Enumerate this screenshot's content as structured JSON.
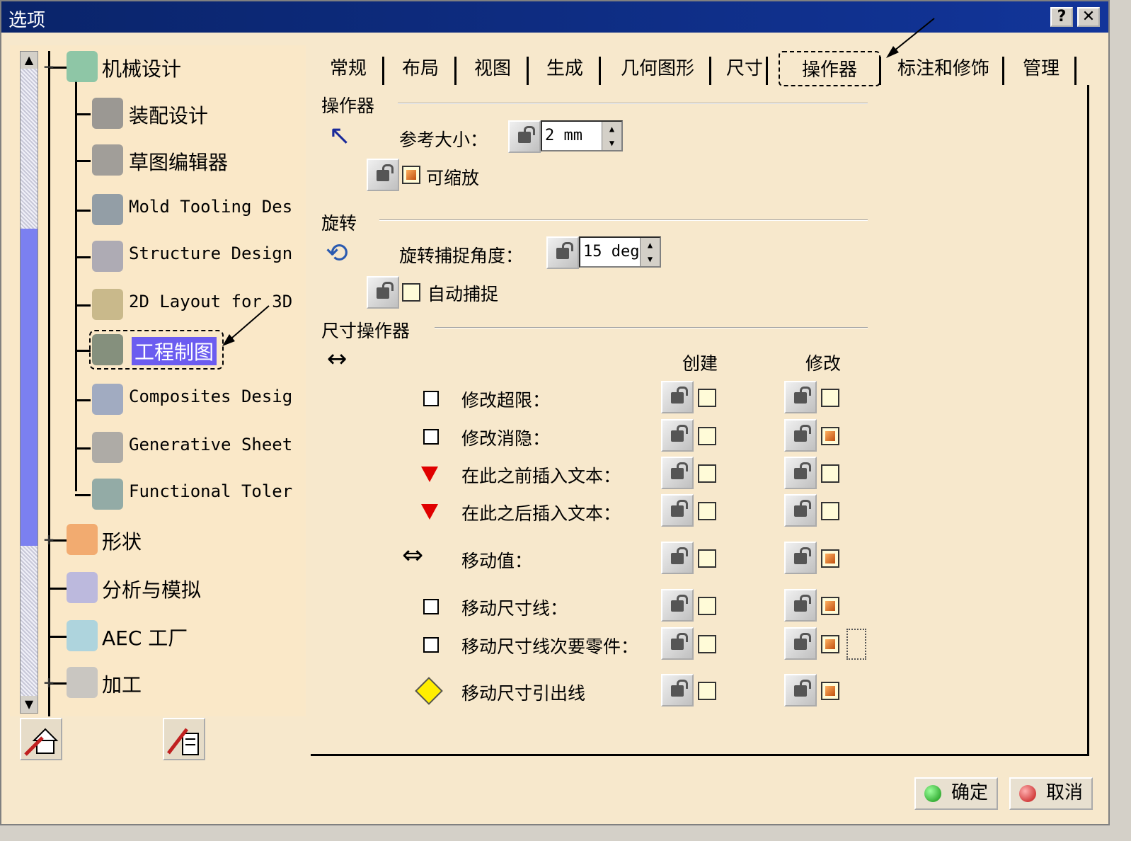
{
  "window": {
    "title": "选项",
    "help_label": "?",
    "close_label": "✕"
  },
  "tree": {
    "items": [
      {
        "label": "机械设计",
        "mono": false
      },
      {
        "label": "装配设计",
        "mono": false
      },
      {
        "label": "草图编辑器",
        "mono": false
      },
      {
        "label": "Mold Tooling Des",
        "mono": true
      },
      {
        "label": "Structure Design",
        "mono": true
      },
      {
        "label": "2D Layout for 3D",
        "mono": true
      },
      {
        "label": "工程制图",
        "mono": false,
        "selected": true
      },
      {
        "label": "Composites Desig",
        "mono": true
      },
      {
        "label": "Generative Sheet",
        "mono": true
      },
      {
        "label": "Functional Toler",
        "mono": true
      },
      {
        "label": "形状",
        "mono": false
      },
      {
        "label": "分析与模拟",
        "mono": false
      },
      {
        "label": "AEC 工厂",
        "mono": false
      },
      {
        "label": "加工",
        "mono": false
      }
    ],
    "expander_plus": "+",
    "expander_minus": "−",
    "scroll_up": "▲",
    "scroll_down": "▼"
  },
  "tabs": [
    "常规",
    "布局",
    "视图",
    "生成",
    "几何图形",
    "尺寸",
    "操作器",
    "标注和修饰",
    "管理"
  ],
  "active_tab": "操作器",
  "sections": {
    "manipulator": {
      "title": "操作器",
      "ref_size_label": "参考大小：",
      "ref_size_value": "2 mm",
      "scalable_label": "可缩放",
      "scalable_checked": true
    },
    "rotation": {
      "title": "旋转",
      "snap_angle_label": "旋转捕捉角度：",
      "snap_angle_value": "15 deg",
      "auto_snap_label": "自动捕捉",
      "auto_snap_checked": false
    },
    "dimension": {
      "title": "尺寸操作器",
      "col_create": "创建",
      "col_modify": "修改",
      "rows": [
        {
          "label": "修改超限：",
          "marker": "square",
          "create": false,
          "modify": false
        },
        {
          "label": "修改消隐：",
          "marker": "square",
          "create": false,
          "modify": true
        },
        {
          "label": "在此之前插入文本：",
          "marker": "red-triangle",
          "create": false,
          "modify": false
        },
        {
          "label": "在此之后插入文本：",
          "marker": "red-triangle",
          "create": false,
          "modify": false
        },
        {
          "label": "移动值：",
          "marker": "double-arrow",
          "create": false,
          "modify": true
        },
        {
          "label": "移动尺寸线：",
          "marker": "square",
          "create": false,
          "modify": true
        },
        {
          "label": "移动尺寸线次要零件：",
          "marker": "square",
          "create": false,
          "modify": true
        },
        {
          "label": "移动尺寸引出线",
          "marker": "yellow-diamond",
          "create": false,
          "modify": true
        }
      ]
    }
  },
  "buttons": {
    "ok": "确定",
    "cancel": "取消"
  },
  "icons": {
    "pointer": "↖",
    "rotate": "⟲",
    "dim": "↔",
    "double_arrow": "⇔"
  }
}
